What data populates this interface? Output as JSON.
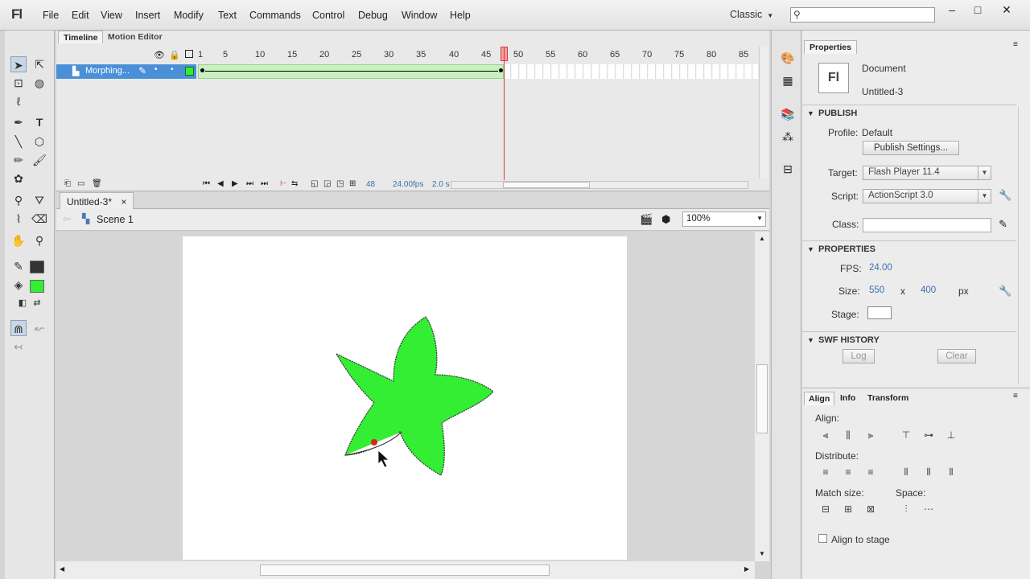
{
  "app": {
    "logo": "Fl"
  },
  "menu": [
    "File",
    "Edit",
    "View",
    "Insert",
    "Modify",
    "Text",
    "Commands",
    "Control",
    "Debug",
    "Window",
    "Help"
  ],
  "workspace": {
    "label": "Classic"
  },
  "search": {
    "placeholder": ""
  },
  "window_buttons": [
    "–",
    "□",
    "✕"
  ],
  "timeline": {
    "tabs": [
      "Timeline",
      "Motion Editor"
    ],
    "ruler": [
      "1",
      "5",
      "10",
      "15",
      "20",
      "25",
      "30",
      "35",
      "40",
      "45",
      "50",
      "55",
      "60",
      "65",
      "70",
      "75",
      "80",
      "85"
    ],
    "layer_name": "Morphing...",
    "current_frame": "48",
    "fps": "24.00",
    "fps_unit": "fps",
    "time": "2.0 s"
  },
  "document_tab": {
    "label": "Untitled-3*",
    "close": "×"
  },
  "scene": {
    "label": "Scene 1"
  },
  "zoom": {
    "value": "100%"
  },
  "properties": {
    "tab": "Properties",
    "doc_type": "Document",
    "doc_name": "Untitled-3",
    "doc_icon": "Fl",
    "publish": {
      "header": "PUBLISH",
      "profile_label": "Profile:",
      "profile_value": "Default",
      "publish_settings": "Publish Settings...",
      "target_label": "Target:",
      "target_value": "Flash Player 11.4",
      "script_label": "Script:",
      "script_value": "ActionScript 3.0",
      "class_label": "Class:"
    },
    "props": {
      "header": "PROPERTIES",
      "fps_label": "FPS:",
      "fps_value": "24.00",
      "size_label": "Size:",
      "width": "550",
      "x": "x",
      "height": "400",
      "unit": "px",
      "stage_label": "Stage:"
    },
    "swf_history": {
      "header": "SWF HISTORY",
      "log": "Log",
      "clear": "Clear"
    }
  },
  "align_panel": {
    "tabs": [
      "Align",
      "Info",
      "Transform"
    ],
    "align_label": "Align:",
    "distribute_label": "Distribute:",
    "match_label": "Match size:",
    "space_label": "Space:",
    "align_to_stage": "Align to stage"
  },
  "colors": {
    "stroke": "#333333",
    "fill": "#33ee33",
    "layer_highlight": "#4a90d9",
    "playhead": "#d83a3a"
  }
}
